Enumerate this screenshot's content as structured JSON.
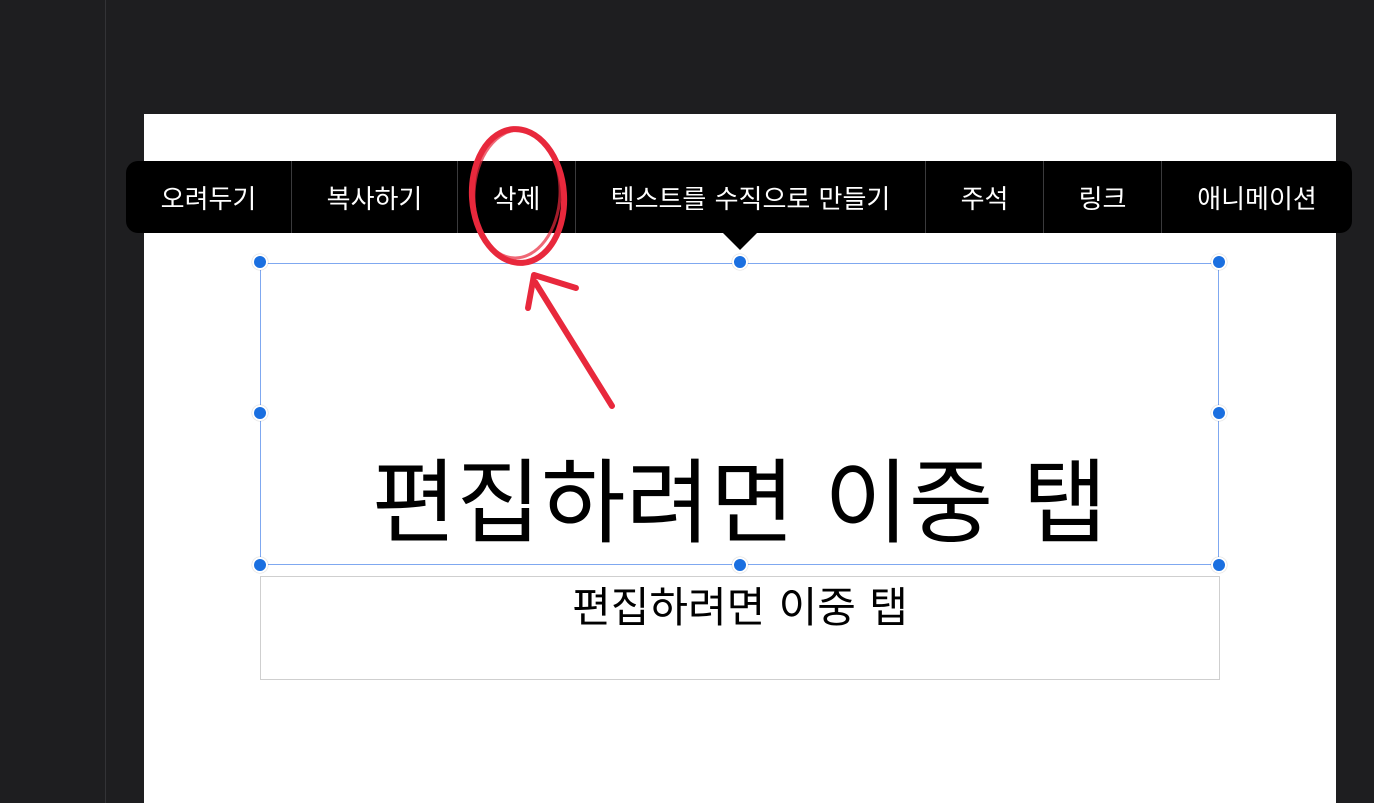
{
  "context_menu": {
    "items": [
      {
        "label": "오려두기"
      },
      {
        "label": "복사하기"
      },
      {
        "label": "삭제"
      },
      {
        "label": "텍스트를 수직으로 만들기"
      },
      {
        "label": "주석"
      },
      {
        "label": "링크"
      },
      {
        "label": "애니메이션"
      }
    ]
  },
  "slide": {
    "title": "편집하려면 이중 탭",
    "subtitle": "편집하려면 이중 탭"
  },
  "colors": {
    "background": "#1e1e20",
    "menu": "#000000",
    "handle": "#1a6fe0",
    "selection": "#7fa8f0",
    "annotation": "#e8283c"
  }
}
